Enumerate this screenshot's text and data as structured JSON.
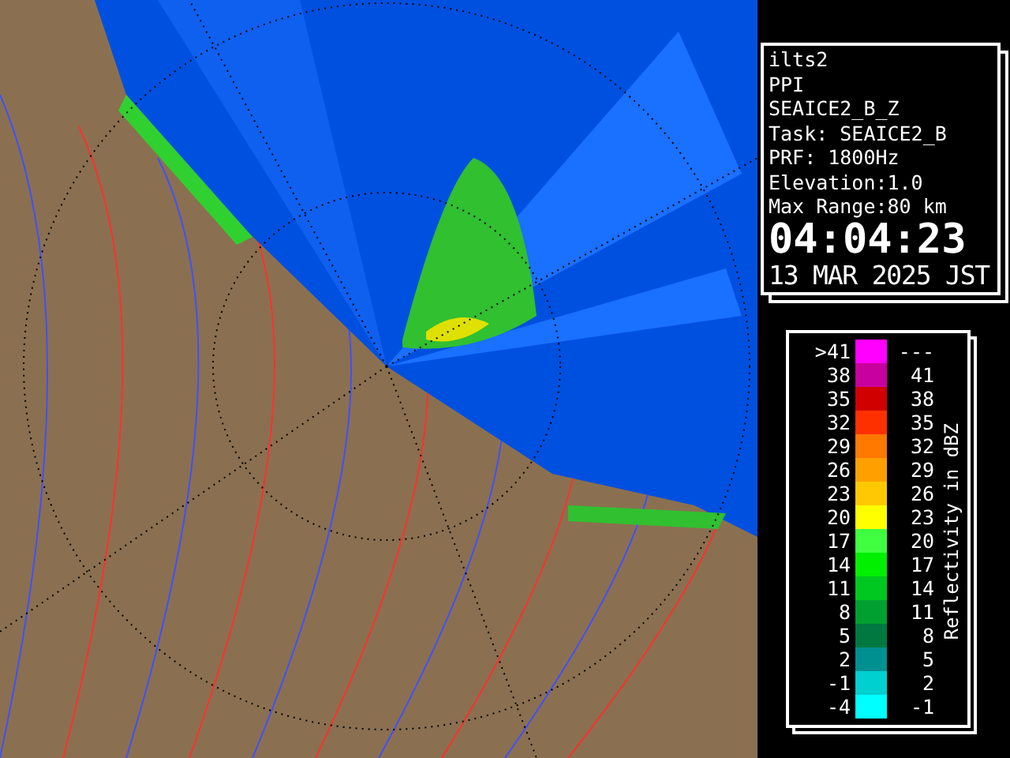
{
  "info": {
    "lines": [
      "ilts2",
      "PPI",
      "SEAICE2_B_Z",
      "Task: SEAICE2_B",
      "PRF: 1800Hz",
      "Elevation:1.0",
      "Max Range:80 km"
    ],
    "time": "04:04:23",
    "date": "13 MAR 2025 JST"
  },
  "legend": {
    "title": "Reflectivity in dBZ",
    "rows": [
      {
        "low": ">41",
        "high": "---",
        "color": "#ff00ff"
      },
      {
        "low": "38",
        "high": "41",
        "color": "#c800a0"
      },
      {
        "low": "35",
        "high": "38",
        "color": "#d00000"
      },
      {
        "low": "32",
        "high": "35",
        "color": "#ff3000"
      },
      {
        "low": "29",
        "high": "32",
        "color": "#ff7800"
      },
      {
        "low": "26",
        "high": "29",
        "color": "#ffa000"
      },
      {
        "low": "23",
        "high": "26",
        "color": "#ffc800"
      },
      {
        "low": "20",
        "high": "23",
        "color": "#ffff00"
      },
      {
        "low": "17",
        "high": "20",
        "color": "#40ff40"
      },
      {
        "low": "14",
        "high": "17",
        "color": "#00f000"
      },
      {
        "low": "11",
        "high": "14",
        "color": "#00c820"
      },
      {
        "low": "8",
        "high": "11",
        "color": "#00a030"
      },
      {
        "low": "5",
        "high": "8",
        "color": "#007840"
      },
      {
        "low": "2",
        "high": "5",
        "color": "#009090"
      },
      {
        "low": "-1",
        "high": "2",
        "color": "#00d0d0"
      },
      {
        "low": "-4",
        "high": "-1",
        "color": "#00ffff"
      }
    ]
  }
}
